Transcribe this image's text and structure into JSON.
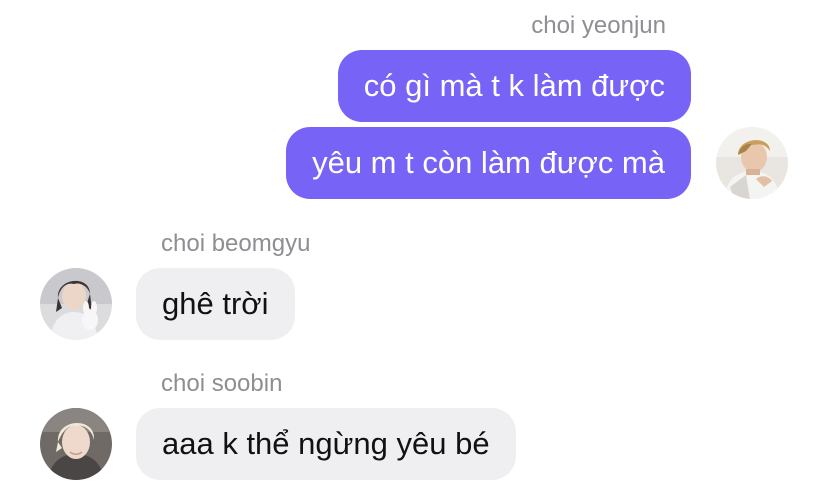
{
  "chat": {
    "groups": [
      {
        "sender": "choi yeonjun",
        "direction": "outgoing",
        "avatar": "yeonjun-avatar",
        "messages": [
          "có gì mà t k làm được",
          "yêu m t còn làm được mà"
        ]
      },
      {
        "sender": "choi beomgyu",
        "direction": "incoming",
        "avatar": "beomgyu-avatar",
        "messages": [
          "ghê trời"
        ]
      },
      {
        "sender": "choi soobin",
        "direction": "incoming",
        "avatar": "soobin-avatar",
        "messages": [
          "aaa k thể ngừng yêu bé"
        ]
      }
    ]
  },
  "colors": {
    "outgoing_bubble": "#7763f5",
    "incoming_bubble": "#efeff1",
    "sender_name": "#8e8e93"
  }
}
